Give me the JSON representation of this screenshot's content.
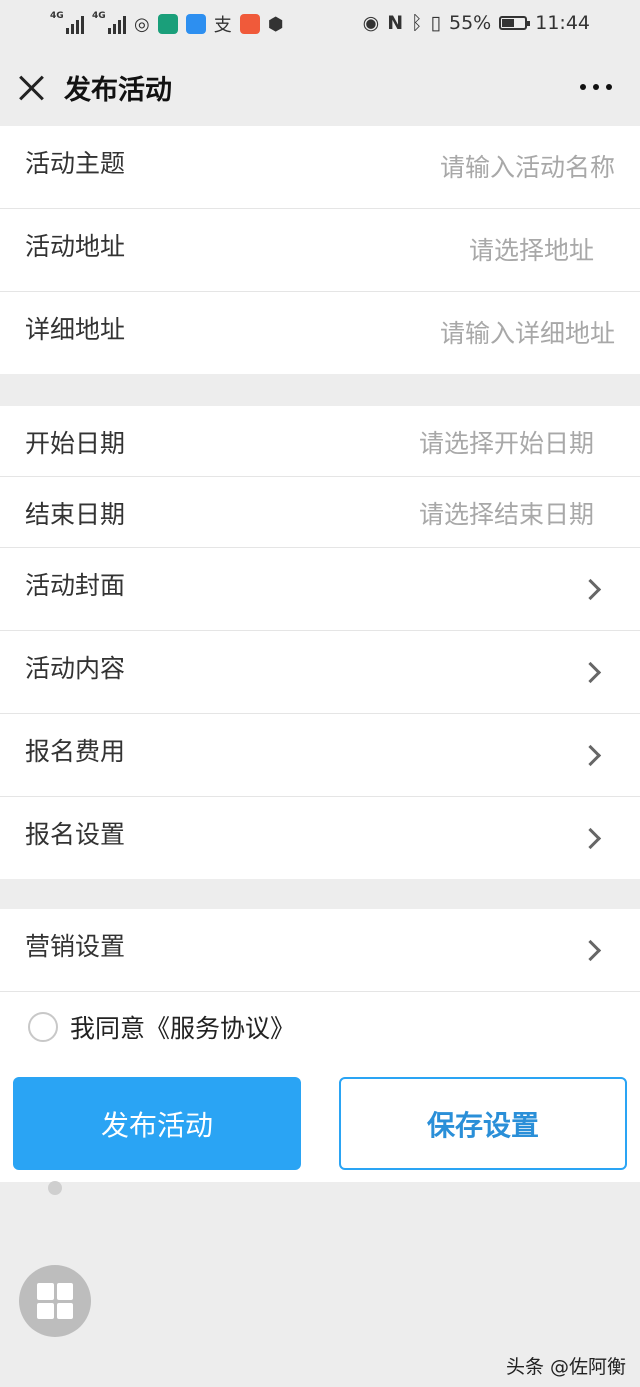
{
  "status_bar": {
    "signal1": "4G",
    "signal2": "4G",
    "battery_percent": "55%",
    "battery_level": 0.55,
    "time": "11:44"
  },
  "header": {
    "title": "发布活动"
  },
  "group1": [
    {
      "label": "活动主题",
      "placeholder": "请输入活动名称"
    },
    {
      "label": "活动地址",
      "placeholder": "请选择地址"
    },
    {
      "label": "详细地址",
      "placeholder": "请输入详细地址"
    }
  ],
  "group2": [
    {
      "label": "开始日期",
      "placeholder": "请选择开始日期"
    },
    {
      "label": "结束日期",
      "placeholder": "请选择结束日期"
    },
    {
      "label": "活动封面"
    },
    {
      "label": "活动内容"
    },
    {
      "label": "报名费用"
    },
    {
      "label": "报名设置"
    }
  ],
  "group3": [
    {
      "label": "营销设置"
    }
  ],
  "agreement": {
    "text": "我同意《服务协议》"
  },
  "buttons": {
    "publish": "发布活动",
    "save": "保存设置"
  },
  "watermark": "头条 @佐阿衡",
  "colors": {
    "accent": "#2aa4f4",
    "background": "#ededed"
  }
}
